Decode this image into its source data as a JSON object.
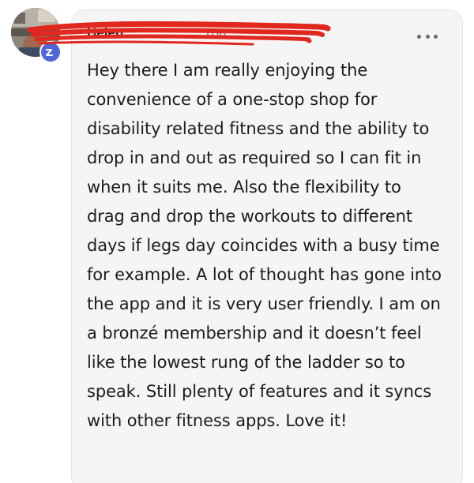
{
  "comment": {
    "author": "Helen",
    "timestamp": "10h",
    "text": "Hey there I am really enjoying the convenience of a one-stop shop for disability related fitness and the ability to drop in and out as required so I can fit in when it suits me. Also the flexibility to drag and drop the workouts to different days if legs day coincides with a busy time for example. A lot of thought has gone into the app and it is very user friendly. I am on a bronzé membership and it doesn’t feel like the lowest rung of the ladder so to speak. Still plenty of features and it syncs with other fitness apps. Love it!"
  },
  "icons": {
    "more": "more-horizontal-icon",
    "badge": "app-badge-icon"
  },
  "colors": {
    "card_background": "#f5f5f5",
    "badge": "#4f67d6",
    "redaction": "#e0281e",
    "text": "#1c1c1c"
  }
}
